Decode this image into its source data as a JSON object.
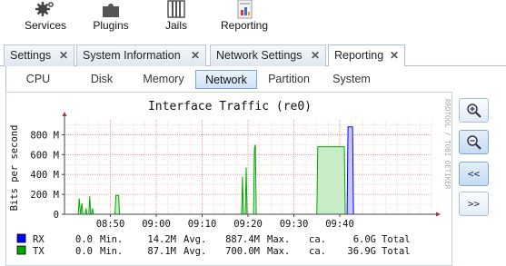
{
  "toolbar": {
    "items": [
      {
        "label": "Services",
        "icon": "gears-icon"
      },
      {
        "label": "Plugins",
        "icon": "puzzle-icon"
      },
      {
        "label": "Jails",
        "icon": "jail-icon"
      },
      {
        "label": "Reporting",
        "icon": "report-icon"
      }
    ]
  },
  "tabs": [
    {
      "label": "Settings"
    },
    {
      "label": "System Information"
    },
    {
      "label": "Network Settings"
    },
    {
      "label": "Reporting",
      "active": true
    }
  ],
  "subtabs": [
    {
      "label": "CPU"
    },
    {
      "label": "Disk"
    },
    {
      "label": "Memory"
    },
    {
      "label": "Network",
      "active": true
    },
    {
      "label": "Partition"
    },
    {
      "label": "System"
    }
  ],
  "side_buttons": {
    "zoom_in_icon": "zoom-in-icon",
    "zoom_out_icon": "zoom-out-icon",
    "back_label": "<<",
    "forward_label": ">>"
  },
  "graph": {
    "watermark": "RRDTOOL / TOBI OETIKER",
    "legend": [
      {
        "name": "RX",
        "color": "#0000ff",
        "min": "0.0",
        "avg": "14.2M",
        "max": "887.4M",
        "total": "6.0G",
        "min_label": "Min.",
        "avg_label": "Avg.",
        "max_label": "Max.",
        "ca_label": "ca.",
        "total_label": "Total"
      },
      {
        "name": "TX",
        "color": "#00aa00",
        "min": "0.0",
        "avg": "87.1M",
        "max": "700.0M",
        "total": "36.9G",
        "min_label": "Min.",
        "avg_label": "Avg.",
        "max_label": "Max.",
        "ca_label": "ca.",
        "total_label": "Total"
      }
    ]
  },
  "chart_data": {
    "type": "area",
    "title": "Interface Traffic (re0)",
    "ylabel": "Bits per second",
    "ylim": [
      0,
      950
    ],
    "yticks": [
      0,
      200,
      400,
      600,
      800
    ],
    "ytick_labels": [
      "0",
      "200 M",
      "400 M",
      "600 M",
      "800 M"
    ],
    "xlim": [
      0,
      80
    ],
    "xticks": [
      10,
      20,
      30,
      40,
      50,
      60,
      70
    ],
    "xtick_labels": [
      "08:50",
      "09:00",
      "09:10",
      "09:20",
      "09:30",
      "09:40"
    ],
    "xtick_positions": [
      10,
      20,
      30,
      40,
      50,
      60
    ],
    "grid": true,
    "legend_position": "bottom-left",
    "series": [
      {
        "name": "RX",
        "color": "#0000ff",
        "fill": "#c8c8ff",
        "points": [
          [
            0,
            0
          ],
          [
            61.6,
            0
          ],
          [
            61.8,
            880
          ],
          [
            62.8,
            880
          ],
          [
            63.0,
            0
          ],
          [
            80,
            0
          ]
        ]
      },
      {
        "name": "TX",
        "color": "#00aa00",
        "fill": "#c8ecc8",
        "points": [
          [
            0,
            0
          ],
          [
            3.0,
            0
          ],
          [
            3.2,
            160
          ],
          [
            3.5,
            0
          ],
          [
            3.8,
            110
          ],
          [
            4.0,
            0
          ],
          [
            4.5,
            0
          ],
          [
            4.7,
            60
          ],
          [
            4.9,
            0
          ],
          [
            5.3,
            0
          ],
          [
            5.5,
            180
          ],
          [
            5.7,
            0
          ],
          [
            5.9,
            0
          ],
          [
            6.1,
            60
          ],
          [
            6.3,
            0
          ],
          [
            11.0,
            0
          ],
          [
            11.2,
            190
          ],
          [
            11.8,
            190
          ],
          [
            12.0,
            0
          ],
          [
            38.6,
            0
          ],
          [
            38.8,
            380
          ],
          [
            39.0,
            0
          ],
          [
            39.4,
            0
          ],
          [
            39.6,
            470
          ],
          [
            39.8,
            0
          ],
          [
            41.2,
            0
          ],
          [
            41.4,
            660
          ],
          [
            41.6,
            700
          ],
          [
            41.8,
            0
          ],
          [
            55.0,
            0
          ],
          [
            55.2,
            680
          ],
          [
            61.0,
            680
          ],
          [
            61.2,
            0
          ],
          [
            80,
            0
          ]
        ]
      }
    ]
  }
}
